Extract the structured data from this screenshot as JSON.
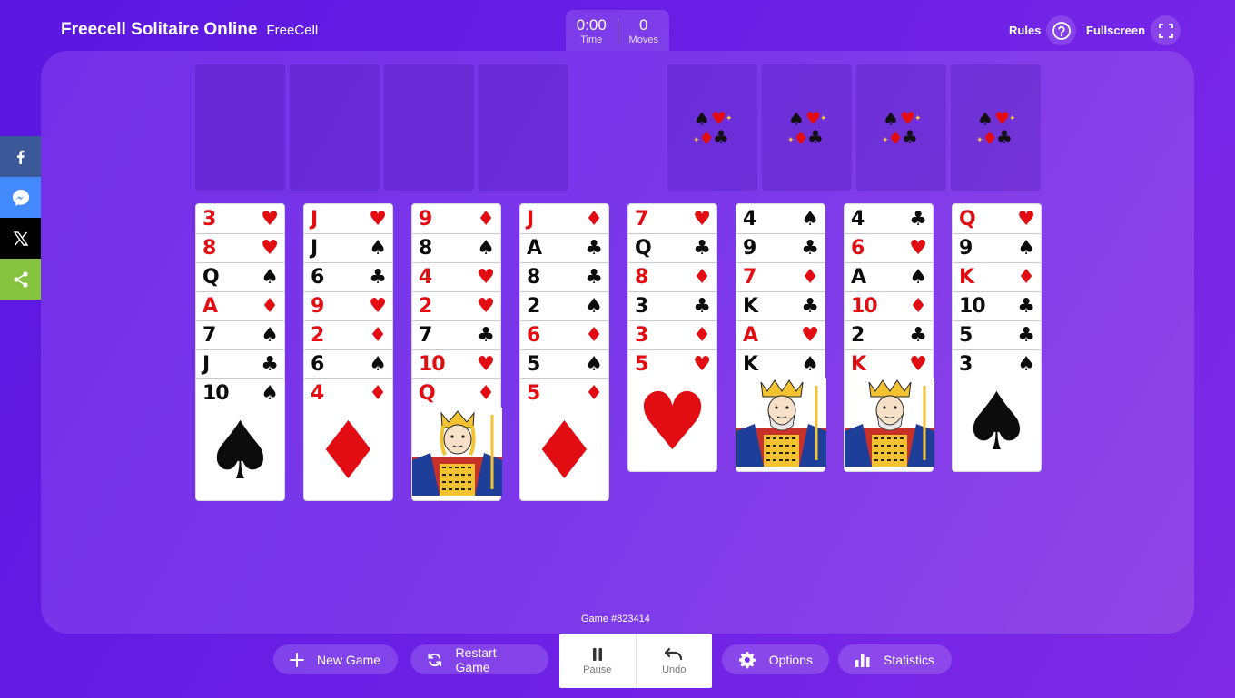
{
  "header": {
    "title": "Freecell Solitaire Online",
    "subtitle": "FreeCell",
    "time_value": "0:00",
    "time_label": "Time",
    "moves_value": "0",
    "moves_label": "Moves",
    "rules_label": "Rules",
    "fullscreen_label": "Fullscreen"
  },
  "social": [
    {
      "name": "facebook",
      "color": "#3b5998"
    },
    {
      "name": "messenger",
      "color": "#448aff"
    },
    {
      "name": "x",
      "color": "#000000"
    },
    {
      "name": "share",
      "color": "#86c440"
    }
  ],
  "board": {
    "free_cells": 4,
    "foundations": 4,
    "game_number": "Game #823414",
    "columns": [
      [
        {
          "r": "3",
          "s": "♥"
        },
        {
          "r": "8",
          "s": "♥"
        },
        {
          "r": "Q",
          "s": "♠"
        },
        {
          "r": "A",
          "s": "♦"
        },
        {
          "r": "7",
          "s": "♠"
        },
        {
          "r": "J",
          "s": "♣"
        },
        {
          "r": "10",
          "s": "♠"
        }
      ],
      [
        {
          "r": "J",
          "s": "♥"
        },
        {
          "r": "J",
          "s": "♠"
        },
        {
          "r": "6",
          "s": "♣"
        },
        {
          "r": "9",
          "s": "♥"
        },
        {
          "r": "2",
          "s": "♦"
        },
        {
          "r": "6",
          "s": "♠"
        },
        {
          "r": "4",
          "s": "♦"
        }
      ],
      [
        {
          "r": "9",
          "s": "♦"
        },
        {
          "r": "8",
          "s": "♠"
        },
        {
          "r": "4",
          "s": "♥"
        },
        {
          "r": "2",
          "s": "♥"
        },
        {
          "r": "7",
          "s": "♣"
        },
        {
          "r": "10",
          "s": "♥"
        },
        {
          "r": "Q",
          "s": "♦"
        }
      ],
      [
        {
          "r": "J",
          "s": "♦"
        },
        {
          "r": "A",
          "s": "♣"
        },
        {
          "r": "8",
          "s": "♣"
        },
        {
          "r": "2",
          "s": "♠"
        },
        {
          "r": "6",
          "s": "♦"
        },
        {
          "r": "5",
          "s": "♠"
        },
        {
          "r": "5",
          "s": "♦"
        }
      ],
      [
        {
          "r": "7",
          "s": "♥"
        },
        {
          "r": "Q",
          "s": "♣"
        },
        {
          "r": "8",
          "s": "♦"
        },
        {
          "r": "3",
          "s": "♣"
        },
        {
          "r": "3",
          "s": "♦"
        },
        {
          "r": "5",
          "s": "♥"
        }
      ],
      [
        {
          "r": "4",
          "s": "♠"
        },
        {
          "r": "9",
          "s": "♣"
        },
        {
          "r": "7",
          "s": "♦"
        },
        {
          "r": "K",
          "s": "♣"
        },
        {
          "r": "A",
          "s": "♥"
        },
        {
          "r": "K",
          "s": "♠"
        }
      ],
      [
        {
          "r": "4",
          "s": "♣"
        },
        {
          "r": "6",
          "s": "♥"
        },
        {
          "r": "A",
          "s": "♠"
        },
        {
          "r": "10",
          "s": "♦"
        },
        {
          "r": "2",
          "s": "♣"
        },
        {
          "r": "K",
          "s": "♥"
        }
      ],
      [
        {
          "r": "Q",
          "s": "♥"
        },
        {
          "r": "9",
          "s": "♠"
        },
        {
          "r": "K",
          "s": "♦"
        },
        {
          "r": "10",
          "s": "♣"
        },
        {
          "r": "5",
          "s": "♣"
        },
        {
          "r": "3",
          "s": "♠"
        }
      ]
    ]
  },
  "toolbar": {
    "new_game": "New Game",
    "restart_game": "Restart Game",
    "pause": "Pause",
    "undo": "Undo",
    "options": "Options",
    "statistics": "Statistics"
  }
}
